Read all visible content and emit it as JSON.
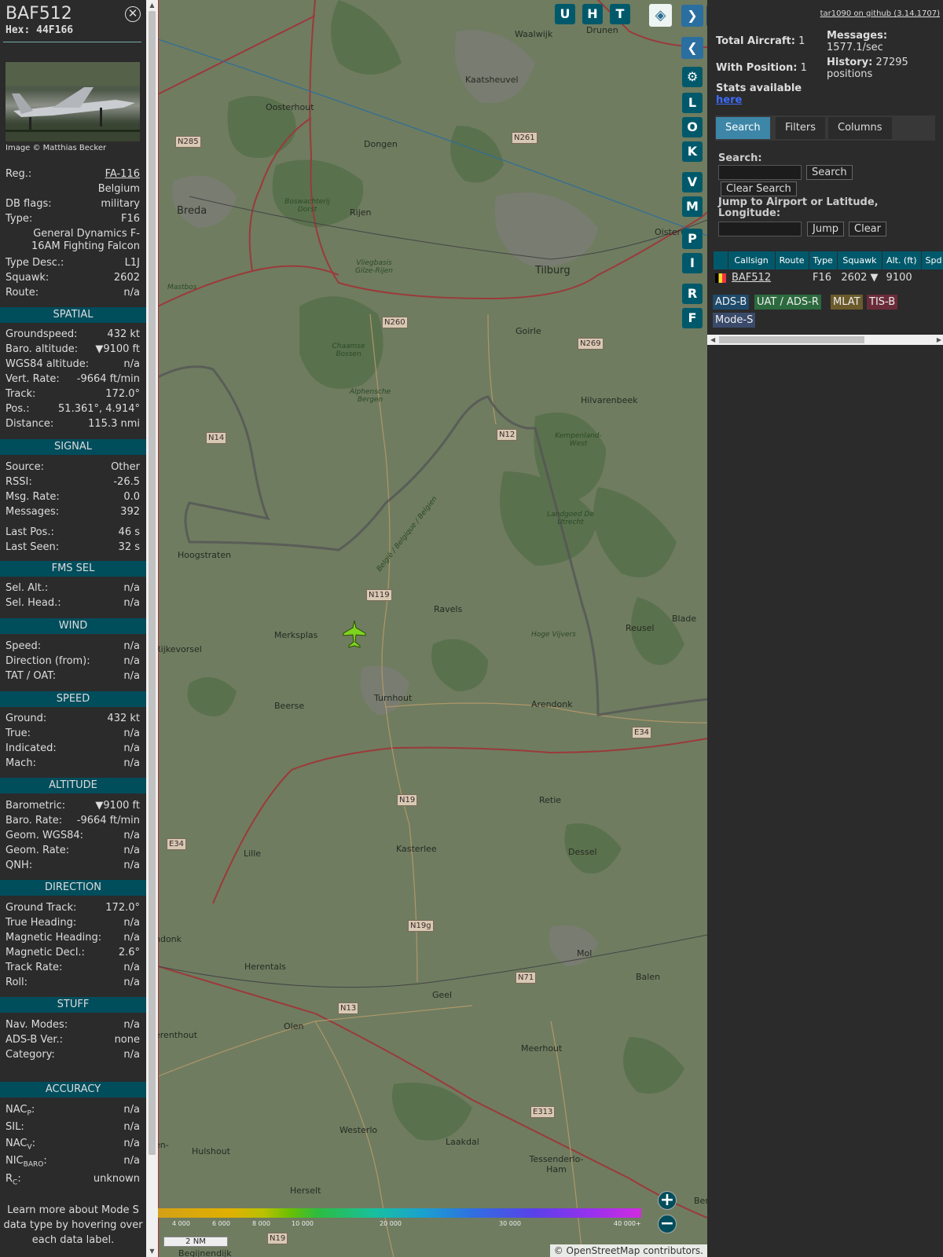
{
  "aircraft": {
    "callsign": "BAF512",
    "hex_label": "Hex:",
    "hex": "44F166",
    "image_credit": "Image © Matthias Becker"
  },
  "details": {
    "reg_k": "Reg.:",
    "reg_v": "FA-116",
    "country": "Belgium",
    "dbflags_k": "DB flags:",
    "dbflags_v": "military",
    "type_k": "Type:",
    "type_v": "F16",
    "type_full": "General Dynamics F-16AM Fighting Falcon",
    "typedesc_k": "Type Desc.:",
    "typedesc_v": "L1J",
    "squawk_k": "Squawk:",
    "squawk_v": "2602",
    "route_k": "Route:",
    "route_v": "n/a"
  },
  "sections": {
    "spatial": "SPATIAL",
    "signal": "SIGNAL",
    "fmssel": "FMS SEL",
    "wind": "WIND",
    "speed": "SPEED",
    "altitude": "ALTITUDE",
    "direction": "DIRECTION",
    "stuff": "STUFF",
    "accuracy": "ACCURACY"
  },
  "spatial": {
    "gs_k": "Groundspeed:",
    "gs_v": "432 kt",
    "baro_k": "Baro. altitude:",
    "baro_v": "▼9100 ft",
    "wgs_k": "WGS84 altitude:",
    "wgs_v": "n/a",
    "vr_k": "Vert. Rate:",
    "vr_v": "-9664 ft/min",
    "track_k": "Track:",
    "track_v": "172.0°",
    "pos_k": "Pos.:",
    "pos_v": "51.361°, 4.914°",
    "dist_k": "Distance:",
    "dist_v": "115.3 nmi"
  },
  "signal": {
    "src_k": "Source:",
    "src_v": "Other",
    "rssi_k": "RSSI:",
    "rssi_v": "-26.5",
    "msgr_k": "Msg. Rate:",
    "msgr_v": "0.0",
    "msgs_k": "Messages:",
    "msgs_v": "392",
    "lpos_k": "Last Pos.:",
    "lpos_v": "46 s",
    "lseen_k": "Last Seen:",
    "lseen_v": "32 s"
  },
  "fmssel": {
    "alt_k": "Sel. Alt.:",
    "alt_v": "n/a",
    "head_k": "Sel. Head.:",
    "head_v": "n/a"
  },
  "wind": {
    "spd_k": "Speed:",
    "spd_v": "n/a",
    "dir_k": "Direction (from):",
    "dir_v": "n/a",
    "tat_k": "TAT / OAT:",
    "tat_v": "n/a"
  },
  "speed": {
    "gnd_k": "Ground:",
    "gnd_v": "432 kt",
    "true_k": "True:",
    "true_v": "n/a",
    "ind_k": "Indicated:",
    "ind_v": "n/a",
    "mach_k": "Mach:",
    "mach_v": "n/a"
  },
  "altitude": {
    "baro_k": "Barometric:",
    "baro_v": "▼9100 ft",
    "rate_k": "Baro. Rate:",
    "rate_v": "-9664 ft/min",
    "geom_k": "Geom. WGS84:",
    "geom_v": "n/a",
    "grate_k": "Geom. Rate:",
    "grate_v": "n/a",
    "qnh_k": "QNH:",
    "qnh_v": "n/a"
  },
  "direction": {
    "gt_k": "Ground Track:",
    "gt_v": "172.0°",
    "th_k": "True Heading:",
    "th_v": "n/a",
    "mh_k": "Magnetic Heading:",
    "mh_v": "n/a",
    "md_k": "Magnetic Decl.:",
    "md_v": "2.6°",
    "tr_k": "Track Rate:",
    "tr_v": "n/a",
    "roll_k": "Roll:",
    "roll_v": "n/a"
  },
  "stuff": {
    "nav_k": "Nav. Modes:",
    "nav_v": "n/a",
    "adsb_k": "ADS-B Ver.:",
    "adsb_v": "none",
    "cat_k": "Category:",
    "cat_v": "n/a"
  },
  "accuracy": {
    "nacp_k": "NAC",
    "nacp_sub": "P",
    "nacp_v": "n/a",
    "sil_k": "SIL:",
    "sil_v": "n/a",
    "nacv_k": "NAC",
    "nacv_sub": "V",
    "nacv_v": "n/a",
    "nic_k": "NIC",
    "nic_sub": "BARO",
    "nic_v": "n/a",
    "rc_k": "R",
    "rc_sub": "C",
    "rc_v": "unknown"
  },
  "learn_more": "Learn more about Mode S data type by hovering over each data label.",
  "map": {
    "buttons_top": [
      "U",
      "H",
      "T"
    ],
    "buttons_side": [
      "L",
      "O",
      "K",
      "V",
      "M",
      "P",
      "I",
      "R",
      "F"
    ],
    "scale": "2 NM",
    "attribution_sym": "©",
    "attribution_link": "OpenStreetMap",
    "attribution_rest": "contributors.",
    "altitude_scale": [
      "4 000",
      "6 000",
      "8 000",
      "10 000",
      "20 000",
      "30 000",
      "40 000+"
    ],
    "places": {
      "breda": "Breda",
      "tilburg": "Tilburg",
      "oosterhout": "Oosterhout",
      "dongen": "Dongen",
      "rijen": "Rijen",
      "goirle": "Goirle",
      "hilvarenbeek": "Hilvarenbeek",
      "kaatsheuvel": "Kaatsheuvel",
      "waalwijk": "Waalwijk",
      "drunen": "Drunen",
      "oisterwijk": "Oisterw",
      "hoogstraten": "Hoogstraten",
      "merksplas": "Merksplas",
      "ravels": "Ravels",
      "rijkevorsel": "Rijkevorsel",
      "beerse": "Beerse",
      "turnhout": "Turnhout",
      "arendonk": "Arendonk",
      "reusel": "Reusel",
      "retie": "Retie",
      "kasterlee": "Kasterlee",
      "dessel": "Dessel",
      "lille": "Lille",
      "mol": "Mol",
      "balen": "Balen",
      "herentals": "Herentals",
      "geel": "Geel",
      "olen": "Olen",
      "meerhout": "Meerhout",
      "westerlo": "Westerlo",
      "laakdal": "Laakdal",
      "tessenderlo": "Tessenderlo-Ham",
      "hulshout": "Hulshout",
      "herselt": "Herselt",
      "blade": "Blade",
      "ondonk": "ndonk",
      "erenthout": "erenthout",
      "en": "en-",
      "beglinendijk": "Begijnendijk",
      "ber": "Ber",
      "vliegbasis": "Vliegbasis Gilze-Rijen",
      "chaamse": "Chaamse Bossen",
      "alphensche": "Alphensche Bergen",
      "kempenland": "Kempenland-West",
      "landgoed": "Landgoed De Utrecht",
      "hoge": "Hoge Vijvers",
      "mastbos": "Mastbos",
      "boswachterij": "Boswachterij Dorst",
      "border": "België / Belgique / Belgien"
    },
    "roads": [
      "N285",
      "N261",
      "N260",
      "N269",
      "N14",
      "N12",
      "N119",
      "N19",
      "E34",
      "N19g",
      "N71",
      "N13",
      "E313",
      "N19",
      "E34"
    ]
  },
  "side": {
    "github": "tar1090 on github (3.14.1707)",
    "total_label": "Total Aircraft:",
    "total_value": "1",
    "withpos_label": "With Position:",
    "withpos_value": "1",
    "stats_label": "Stats available",
    "stats_link": "here",
    "messages_label": "Messages:",
    "messages_value": "1577.1/sec",
    "history_label": "History:",
    "history_value": "27295 positions",
    "tabs": [
      "Search",
      "Filters",
      "Columns"
    ],
    "search_label": "Search:",
    "search_btn": "Search",
    "clear_search_btn": "Clear Search",
    "jump_label": "Jump to Airport or Latitude, Longitude:",
    "jump_btn": "Jump",
    "clear_btn": "Clear",
    "table_headers": [
      "Callsign",
      "Route",
      "Type",
      "Squawk",
      "Alt. (ft)",
      "Spd"
    ],
    "table_row": {
      "callsign": "BAF512",
      "route": "",
      "type": "F16",
      "squawk": "2602",
      "alt_arrow": "▼",
      "alt": "9100"
    },
    "sources": [
      "ADS-B",
      "UAT / ADS-R",
      "MLAT",
      "TIS-B",
      "Mode-S"
    ],
    "source_colors": [
      "#1e4a6b",
      "#2c6a3e",
      "#6b5a2c",
      "#6b2c3a",
      "#3a4a6a"
    ]
  }
}
